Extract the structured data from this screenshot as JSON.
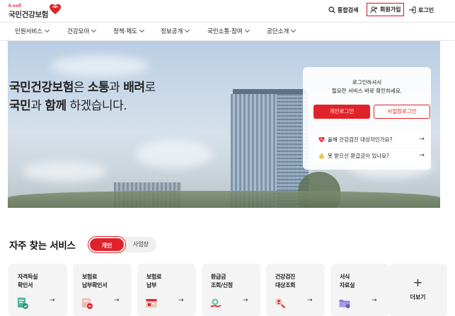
{
  "header": {
    "logo_sub": "h-well",
    "logo_main": "국민건강보험",
    "util_search": "통합검색",
    "util_signup": "회원가입",
    "util_login": "로그인"
  },
  "gnb": {
    "items": [
      "민원서비스",
      "건강모아",
      "정책·제도",
      "정보공개",
      "국민소통·참여",
      "공단소개"
    ]
  },
  "hero": {
    "line1_a": "국민건강보험",
    "line1_b": "은 ",
    "line1_c": "소통",
    "line1_d": "과 ",
    "line1_e": "배려",
    "line1_f": "로",
    "line2_a": "국민",
    "line2_b": "과 ",
    "line2_c": "함께",
    "line2_d": " 하겠습니다."
  },
  "login_panel": {
    "msg_line1": "로그인하셔서",
    "msg_line2": "필요한 서비스 바로 확인하세요.",
    "btn_personal": "개인로그인",
    "btn_business": "사업장로그인",
    "link1": "올해 건강검진 대상자인가요?",
    "link2": "못 받으신 환급금이 있나요?",
    "arrow": "→"
  },
  "frequent": {
    "title": "자주 찾는 서비스",
    "tab_personal": "개인",
    "tab_business": "사업장",
    "cards": [
      {
        "label": "자격득실\n확인서"
      },
      {
        "label": "보험료\n납부확인서"
      },
      {
        "label": "보험료\n납부"
      },
      {
        "label": "환급금\n조회/신청"
      },
      {
        "label": "건강검진\n대상조회"
      },
      {
        "label": "서식\n자료실"
      }
    ],
    "more_plus": "+",
    "more_label": "더보기",
    "arrow": "→"
  },
  "colors": {
    "brand_red": "#e0222a"
  }
}
